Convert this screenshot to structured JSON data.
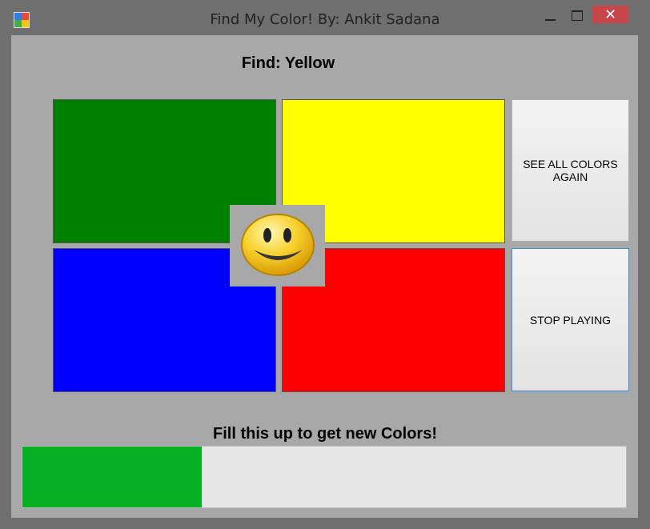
{
  "window": {
    "title": "Find My Color! By: Ankit Sadana",
    "minimize_label": "",
    "maximize_label": "",
    "close_label": "✕"
  },
  "game": {
    "find_prompt": "Find: Yellow",
    "tiles": [
      {
        "color_name": "green",
        "color": "#008000"
      },
      {
        "color_name": "yellow",
        "color": "#ffff00"
      },
      {
        "color_name": "blue",
        "color": "#0000ff"
      },
      {
        "color_name": "red",
        "color": "#ff0000"
      }
    ],
    "feedback_icon": "smiley-face-icon"
  },
  "buttons": {
    "see_all_colors": "SEE ALL COLORS AGAIN",
    "stop_playing": "STOP PLAYING"
  },
  "progress": {
    "label": "Fill this up to get new Colors!",
    "fraction": 0.297,
    "fill_color": "#06b025"
  }
}
